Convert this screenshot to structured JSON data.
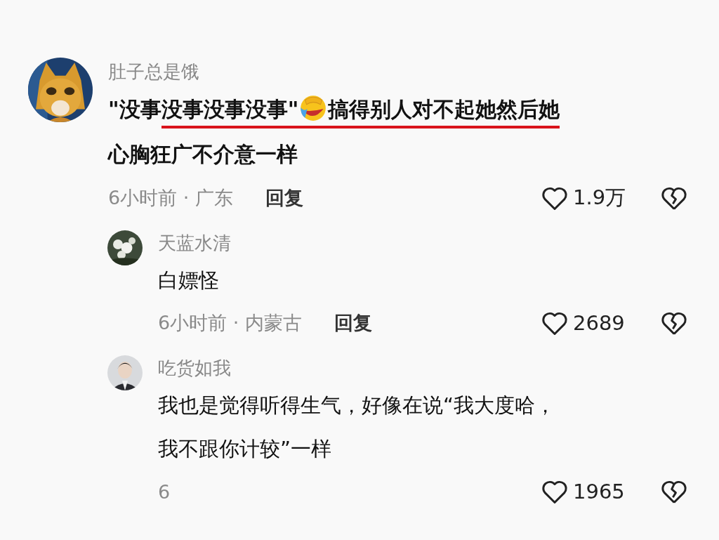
{
  "comments": [
    {
      "author": "肚子总是饿",
      "avatar": {
        "kind": "picture"
      },
      "lines": [
        [
          {
            "kind": "text",
            "text": "\"没事",
            "underlined": false
          },
          {
            "kind": "text",
            "text": "没事没事没事\"",
            "underlined": true
          },
          {
            "kind": "emoji",
            "underlined": true
          },
          {
            "kind": "text",
            "text": "搞得别人对不起她然后她",
            "underlined": true
          }
        ],
        [
          {
            "kind": "text",
            "text": "心胸狂广不介意一样",
            "underlined": false
          }
        ]
      ],
      "meta": "6小时前 · 广东",
      "reply": "回复",
      "likes": "1.9万",
      "children": [
        {
          "author": "天蓝水清",
          "avatar": {
            "kind": "picture"
          },
          "lines": [
            [
              {
                "kind": "text",
                "text": "白嫖怪",
                "underlined": false
              }
            ]
          ],
          "meta": "6小时前 · 内蒙古",
          "reply": "回复",
          "likes": "2689"
        },
        {
          "author": "吃货如我",
          "avatar": {
            "kind": "picture"
          },
          "lines": [
            [
              {
                "kind": "text",
                "text": "我也是觉得听得生气，好像在说“我大度哈，",
                "underlined": false
              }
            ],
            [
              {
                "kind": "text",
                "text": "我不跟你计较”一样",
                "underlined": false
              }
            ]
          ],
          "meta": "6",
          "likes": "1965"
        }
      ]
    }
  ]
}
